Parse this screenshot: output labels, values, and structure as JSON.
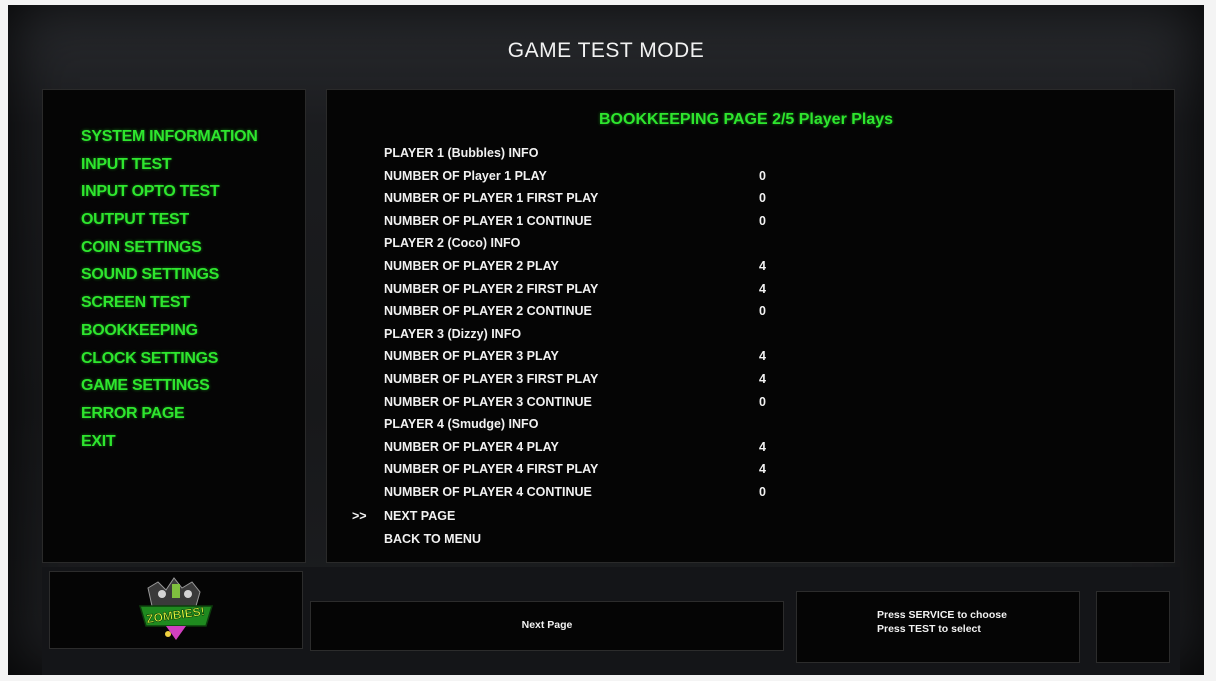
{
  "header": {
    "title": "GAME TEST MODE"
  },
  "menu": {
    "items": [
      "SYSTEM INFORMATION",
      "INPUT TEST",
      "INPUT OPTO TEST",
      "OUTPUT TEST",
      "COIN SETTINGS",
      "SOUND SETTINGS",
      "SCREEN TEST",
      "BOOKKEEPING",
      "CLOCK SETTINGS",
      "GAME SETTINGS",
      "ERROR PAGE",
      "EXIT"
    ]
  },
  "content": {
    "heading": "BOOKKEEPING PAGE 2/5 Player Plays",
    "rows": [
      {
        "label": "PLAYER 1 (Bubbles) INFO",
        "value": ""
      },
      {
        "label": "NUMBER OF Player 1 PLAY",
        "value": "0"
      },
      {
        "label": "NUMBER OF PLAYER 1 FIRST PLAY",
        "value": "0"
      },
      {
        "label": "NUMBER OF PLAYER 1 CONTINUE",
        "value": "0"
      },
      {
        "label": "PLAYER 2 (Coco) INFO",
        "value": ""
      },
      {
        "label": "NUMBER OF PLAYER 2 PLAY",
        "value": "4"
      },
      {
        "label": "NUMBER OF PLAYER 2 FIRST PLAY",
        "value": "4"
      },
      {
        "label": "NUMBER OF PLAYER 2 CONTINUE",
        "value": "0"
      },
      {
        "label": "PLAYER 3 (Dizzy) INFO",
        "value": ""
      },
      {
        "label": "NUMBER OF PLAYER 3 PLAY",
        "value": "4"
      },
      {
        "label": "NUMBER OF PLAYER 3 FIRST PLAY",
        "value": "4"
      },
      {
        "label": "NUMBER OF PLAYER 3 CONTINUE",
        "value": "0"
      },
      {
        "label": "PLAYER 4 (Smudge) INFO",
        "value": ""
      },
      {
        "label": "NUMBER OF PLAYER 4 PLAY",
        "value": "4"
      },
      {
        "label": "NUMBER OF PLAYER 4 FIRST PLAY",
        "value": "4"
      },
      {
        "label": "NUMBER OF PLAYER 4 CONTINUE",
        "value": "0"
      }
    ],
    "cursor": ">>",
    "nav": [
      "NEXT PAGE",
      "BACK TO MENU"
    ]
  },
  "footer": {
    "logo_text": "ZOMBIES!",
    "action_label": "Next Page",
    "help_line1": "Press SERVICE to choose",
    "help_line2": "Press TEST to select"
  },
  "colors": {
    "accent": "#2ee62e",
    "text": "#f2f2f2",
    "panel": "#050505"
  }
}
